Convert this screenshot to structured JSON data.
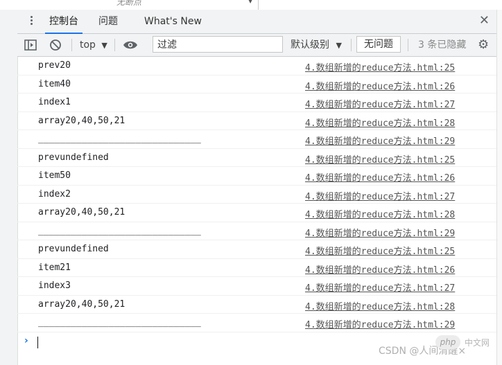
{
  "top_strip": {
    "ghost_text": "无断点"
  },
  "tabs": [
    {
      "label": "控制台",
      "active": true
    },
    {
      "label": "问题",
      "active": false
    },
    {
      "label": "What's New",
      "active": false
    }
  ],
  "toolbar": {
    "context": "top",
    "filter_placeholder": "过滤",
    "levels": "默认级别",
    "issues_button": "无问题",
    "hidden_count": "3 条已隐藏"
  },
  "console_rows": [
    {
      "msg": "prev20",
      "src": "4.数组新增的reduce方法.html:25"
    },
    {
      "msg": "item40",
      "src": "4.数组新增的reduce方法.html:26"
    },
    {
      "msg": "index1",
      "src": "4.数组新增的reduce方法.html:27"
    },
    {
      "msg": "array20,40,50,21",
      "src": "4.数组新增的reduce方法.html:28"
    },
    {
      "msg": "______________________________",
      "src": "4.数组新增的reduce方法.html:29"
    },
    {
      "msg": "prevundefined",
      "src": "4.数组新增的reduce方法.html:25"
    },
    {
      "msg": "item50",
      "src": "4.数组新增的reduce方法.html:26"
    },
    {
      "msg": "index2",
      "src": "4.数组新增的reduce方法.html:27"
    },
    {
      "msg": "array20,40,50,21",
      "src": "4.数组新增的reduce方法.html:28"
    },
    {
      "msg": "______________________________",
      "src": "4.数组新增的reduce方法.html:29"
    },
    {
      "msg": "prevundefined",
      "src": "4.数组新增的reduce方法.html:25"
    },
    {
      "msg": "item21",
      "src": "4.数组新增的reduce方法.html:26"
    },
    {
      "msg": "index3",
      "src": "4.数组新增的reduce方法.html:27"
    },
    {
      "msg": "array20,40,50,21",
      "src": "4.数组新增的reduce方法.html:28"
    },
    {
      "msg": "______________________________",
      "src": "4.数组新增的reduce方法.html:29"
    }
  ],
  "watermark": {
    "text": "CSDN @人间清醒×",
    "php_badge": "php",
    "php_cn": "中文网"
  },
  "colors": {
    "accent": "#1a73e8",
    "toolbar_bg": "#f1f3f4",
    "link": "#545454"
  }
}
